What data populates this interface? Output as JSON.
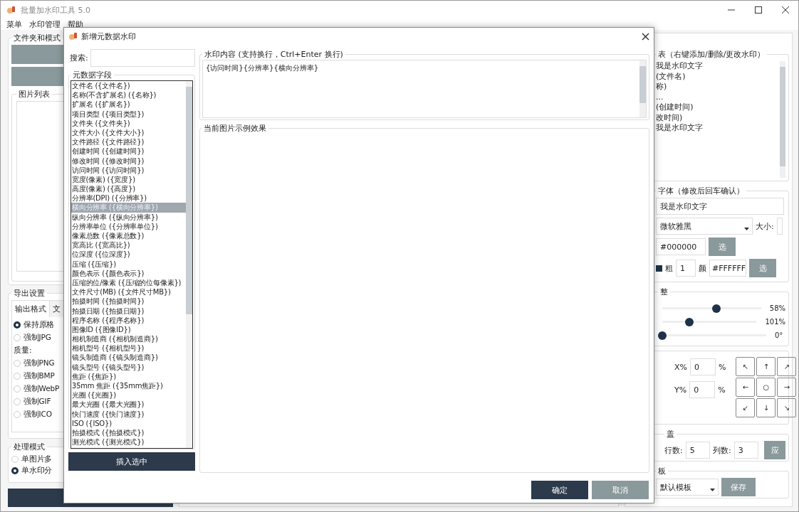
{
  "window": {
    "title": "批量加水印工具 5.0",
    "menu": [
      "菜单",
      "水印管理",
      "帮助"
    ]
  },
  "left_panel": {
    "folder_group": {
      "title": "文件夹和模式"
    },
    "image_list": {
      "title": "图片列表"
    },
    "export": {
      "title": "导出设置",
      "tabs": [
        {
          "label": "输出格式",
          "selected": true
        },
        {
          "label": "文",
          "selected": false
        }
      ],
      "formats": [
        {
          "kind": "radio",
          "label": "保持原格",
          "selected": true
        },
        {
          "kind": "radio",
          "label": "强制JPG",
          "selected": false
        },
        {
          "kind": "label",
          "label": "质量:"
        },
        {
          "kind": "radio",
          "label": "强制PNG",
          "selected": false
        },
        {
          "kind": "radio",
          "label": "强制BMP",
          "selected": false
        },
        {
          "kind": "radio",
          "label": "强制WebP",
          "selected": false
        },
        {
          "kind": "radio",
          "label": "强制GIF",
          "selected": false
        },
        {
          "kind": "radio",
          "label": "强制ICO",
          "selected": false
        }
      ]
    },
    "mode": {
      "title": "处理模式",
      "options": [
        {
          "label": "单图片多",
          "selected": false
        },
        {
          "label": "单水印分",
          "selected": true
        }
      ]
    }
  },
  "right_panel": {
    "list_group": {
      "title": "表（右键添加/删除/更改水印）",
      "items": [
        "我是水印文字",
        "(文件名)",
        "称)",
        "...",
        "(创建时间)",
        "改时间)",
        "我是水印文字"
      ]
    },
    "font_group": {
      "title": "字体（修改后回车确认）",
      "text_value": "我是水印文字",
      "font_value": "微软雅黑",
      "size_label": "大小:",
      "color_value": "#000000",
      "color_button": "选",
      "bold_checked": true,
      "weight_label": "粗",
      "weight_value": "1",
      "stroke_label": "颜",
      "stroke_value": "#FFFFFF",
      "stroke_button": "选"
    },
    "adjust_group": {
      "title": "整",
      "sliders": [
        {
          "level": 0.55,
          "reading": "58%"
        },
        {
          "level": 0.29,
          "reading": "101%"
        },
        {
          "level": 0.0,
          "reading": "0°"
        }
      ]
    },
    "position_group": {
      "x_label": "X%",
      "x_value": "0",
      "x_unit": "%",
      "y_label": "Y%",
      "y_value": "0",
      "y_unit": "%",
      "grid": [
        "↖",
        "↑",
        "↗",
        "←",
        "○",
        "→",
        "↙",
        "↓",
        "↘"
      ]
    },
    "tile_group": {
      "title": "盖",
      "rows_label": "行数:",
      "rows_value": "5",
      "cols_label": "列数:",
      "cols_value": "3",
      "apply_button": "应"
    },
    "template_group": {
      "title": "板",
      "value": "默认模板",
      "save_button": "保存"
    }
  },
  "dialog": {
    "title": "新增元数据水印",
    "search": {
      "label": "搜索:"
    },
    "fields": {
      "title": "元数据字段",
      "items": [
        {
          "label": "文件名 ({文件名})",
          "selected": false
        },
        {
          "label": "名称(不含扩展名) ({名称})",
          "selected": false
        },
        {
          "label": "扩展名 ({扩展名})",
          "selected": false
        },
        {
          "label": "项目类型 ({项目类型})",
          "selected": false
        },
        {
          "label": "文件夹 ({文件夹})",
          "selected": false
        },
        {
          "label": "文件大小 ({文件大小})",
          "selected": false
        },
        {
          "label": "文件路径 ({文件路径})",
          "selected": false
        },
        {
          "label": "创建时间 ({创建时间})",
          "selected": false
        },
        {
          "label": "修改时间 ({修改时间})",
          "selected": false
        },
        {
          "label": "访问时间 ({访问时间})",
          "selected": false
        },
        {
          "label": "宽度(像素) ({宽度})",
          "selected": false
        },
        {
          "label": "高度(像素) ({高度})",
          "selected": false
        },
        {
          "label": "分辨率(DPI) ({分辨率})",
          "selected": false
        },
        {
          "label": "横向分辨率 ({横向分辨率})",
          "selected": true
        },
        {
          "label": "纵向分辨率 ({纵向分辨率})",
          "selected": false
        },
        {
          "label": "分辨率单位 ({分辨率单位})",
          "selected": false
        },
        {
          "label": "像素总数 ({像素总数})",
          "selected": false
        },
        {
          "label": "宽高比 ({宽高比})",
          "selected": false
        },
        {
          "label": "位深度 ({位深度})",
          "selected": false
        },
        {
          "label": "压缩 ({压缩})",
          "selected": false
        },
        {
          "label": "颜色表示 ({颜色表示})",
          "selected": false
        },
        {
          "label": "压缩的位/像素 ({压缩的位每像素})",
          "selected": false
        },
        {
          "label": "文件尺寸(MB) ({文件尺寸MB})",
          "selected": false
        },
        {
          "label": "拍摄时间 ({拍摄时间})",
          "selected": false
        },
        {
          "label": "拍摄日期 ({拍摄日期})",
          "selected": false
        },
        {
          "label": "程序名称 ({程序名称})",
          "selected": false
        },
        {
          "label": "图像ID ({图像ID})",
          "selected": false
        },
        {
          "label": "相机制造商 ({相机制造商})",
          "selected": false
        },
        {
          "label": "相机型号 ({相机型号})",
          "selected": false
        },
        {
          "label": "镜头制造商 ({镜头制造商})",
          "selected": false
        },
        {
          "label": "镜头型号 ({镜头型号})",
          "selected": false
        },
        {
          "label": "焦距 ({焦距})",
          "selected": false
        },
        {
          "label": "35mm 焦距 ({35mm焦距})",
          "selected": false
        },
        {
          "label": "光圈 ({光圈})",
          "selected": false
        },
        {
          "label": "最大光圈 ({最大光圈})",
          "selected": false
        },
        {
          "label": "快门速度 ({快门速度})",
          "selected": false
        },
        {
          "label": "ISO ({ISO})",
          "selected": false
        },
        {
          "label": "拍摄模式 ({拍摄模式})",
          "selected": false
        },
        {
          "label": "测光模式 ({测光模式})",
          "selected": false
        }
      ]
    },
    "insert_button": "插入选中",
    "content": {
      "title": "水印内容 (支持换行，Ctrl+Enter 换行)",
      "value": "{访问时间}{分辨率}{横向分辨率}"
    },
    "preview": {
      "title": "当前图片示例效果"
    },
    "buttons": [
      {
        "label": "确定",
        "kind": "primary"
      },
      {
        "label": "取消",
        "kind": "secondary"
      }
    ]
  }
}
